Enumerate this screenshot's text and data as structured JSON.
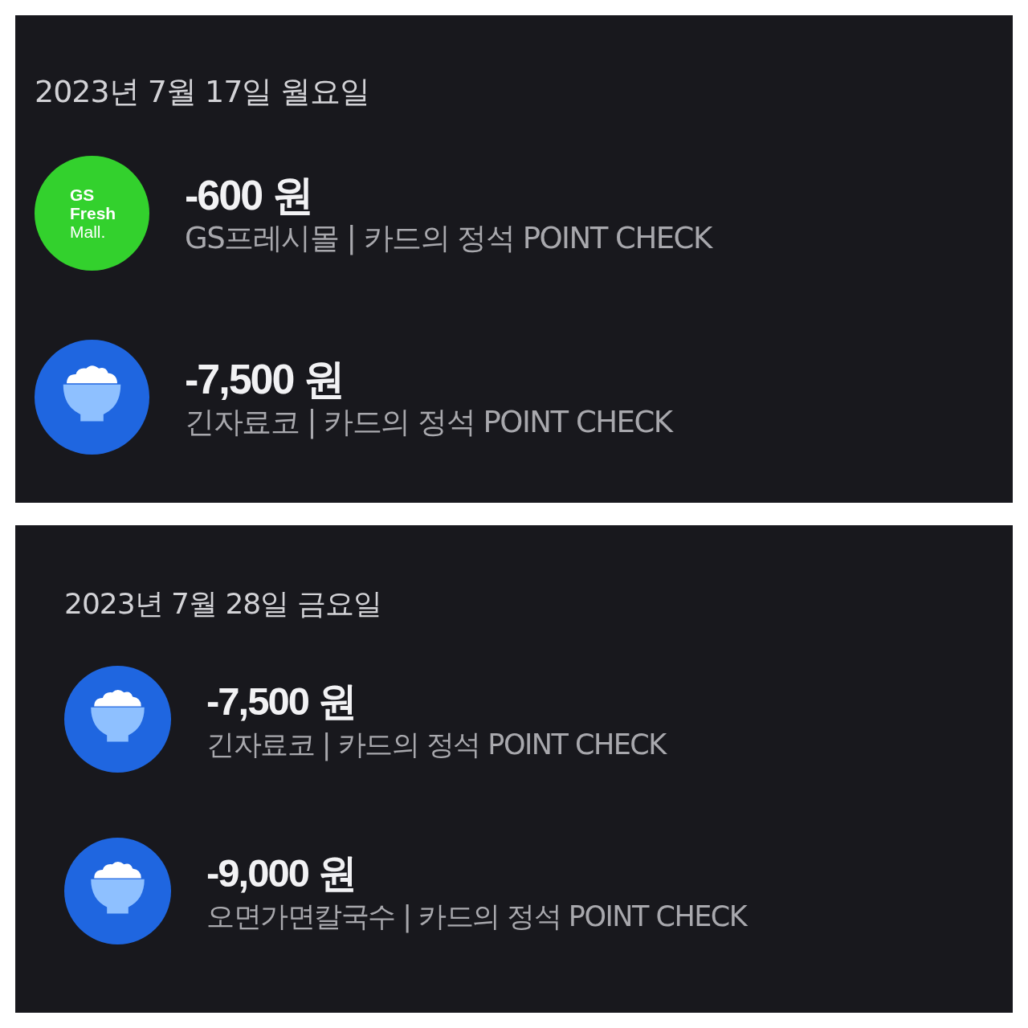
{
  "panels": [
    {
      "date": "2023년 7월 17일 월요일",
      "transactions": [
        {
          "logo": {
            "kind": "brand",
            "lines": [
              "GS",
              "Fresh",
              "Mall."
            ]
          },
          "amount": "-600 원",
          "description": "GS프레시몰 | 카드의 정석 POINT CHECK"
        },
        {
          "logo": {
            "kind": "rice"
          },
          "amount": "-7,500 원",
          "description": "긴자료코 | 카드의 정석 POINT CHECK"
        }
      ]
    },
    {
      "date": "2023년 7월 28일 금요일",
      "transactions": [
        {
          "logo": {
            "kind": "rice"
          },
          "amount": "-7,500 원",
          "description": "긴자료코 | 카드의 정석 POINT CHECK"
        },
        {
          "logo": {
            "kind": "rice"
          },
          "amount": "-9,000 원",
          "description": "오면가면칼국수 | 카드의 정석 POINT CHECK"
        }
      ]
    }
  ]
}
